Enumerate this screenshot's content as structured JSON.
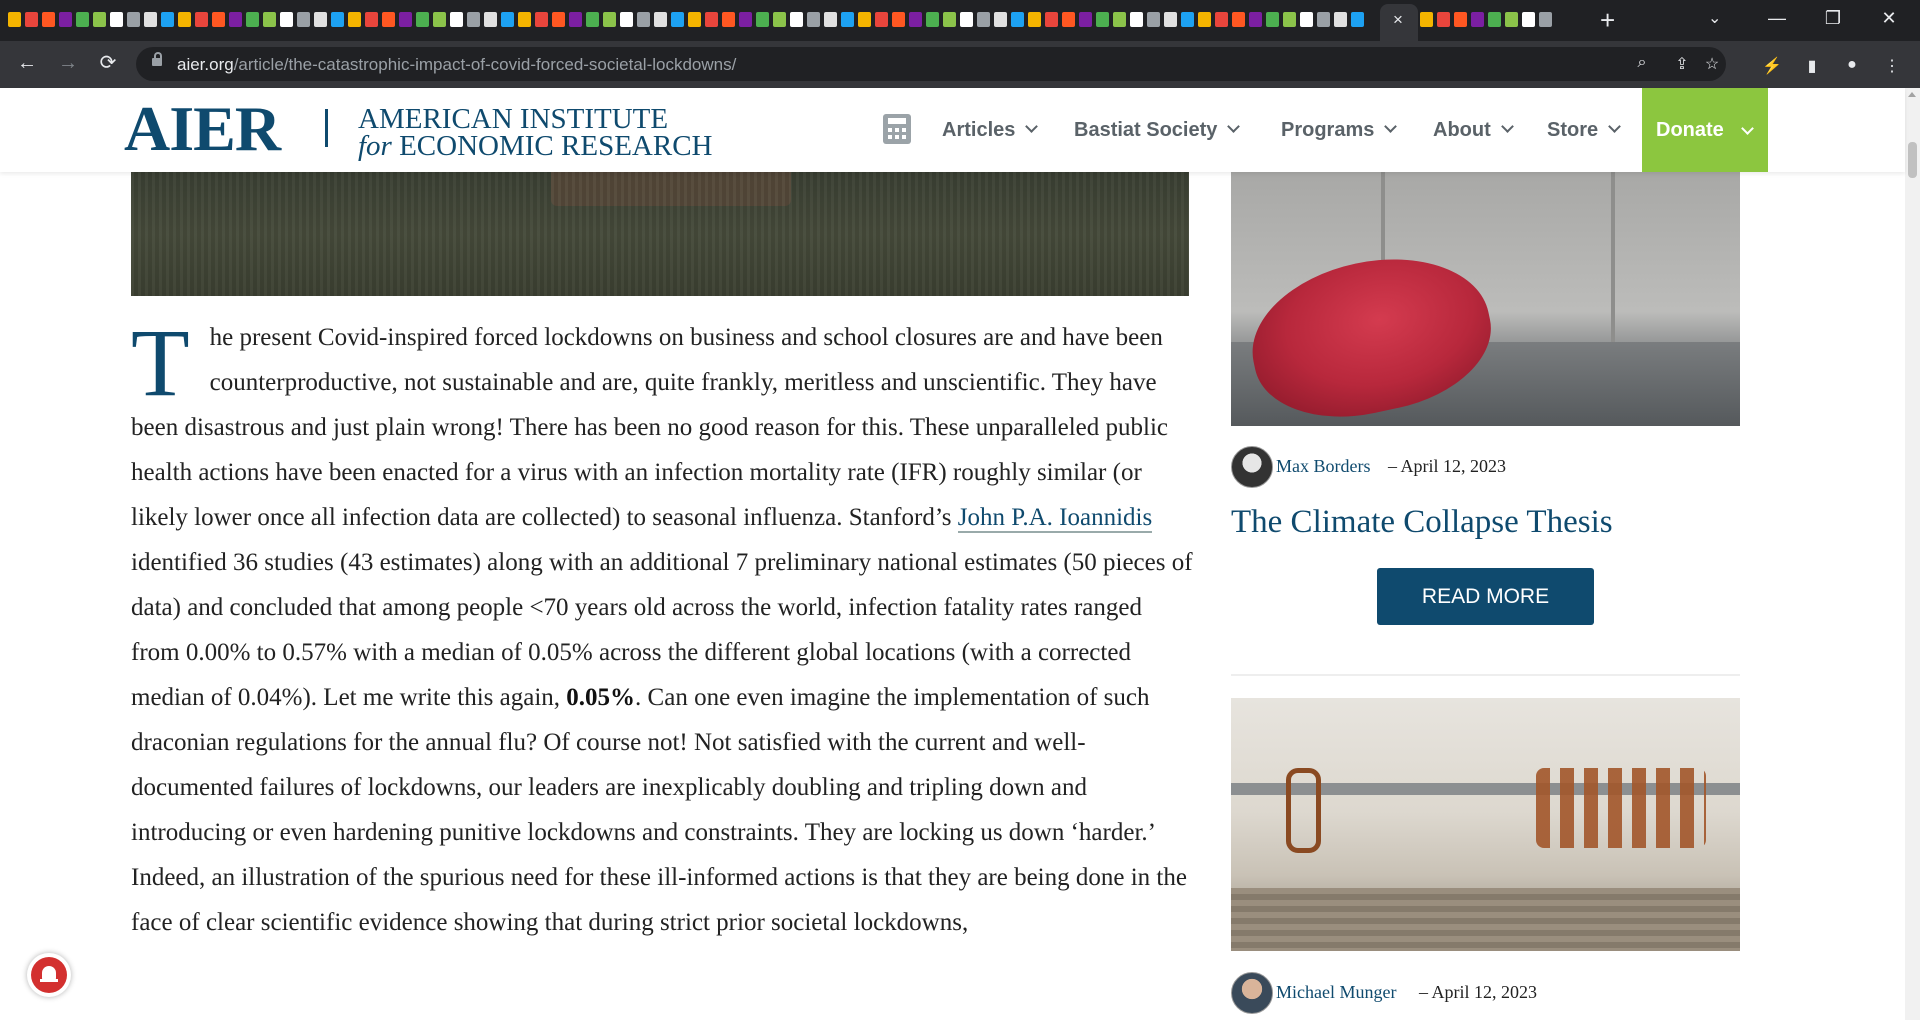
{
  "browser": {
    "url_host": "aier.org",
    "url_path": "/article/the-catastrophic-impact-of-covid-forced-societal-lockdowns/",
    "tab_close_glyph": "×",
    "new_tab_glyph": "+",
    "icons": {
      "back": "←",
      "forward": "→",
      "reload": "⟳",
      "zoom": "⌕",
      "share": "⇪",
      "star": "☆",
      "extension": "⚡",
      "sidepanel": "▮",
      "profile": "●",
      "menu": "⋮",
      "tabsearch": "⌄",
      "minimize": "—",
      "restore": "❐",
      "close": "✕"
    }
  },
  "site": {
    "logo_short": "AIER",
    "logo_line1": "AMERICAN INSTITUTE",
    "logo_line2_italic": "for",
    "logo_line2": "ECONOMIC RESEARCH",
    "nav": [
      "Articles",
      "Bastiat Society",
      "Programs",
      "About",
      "Store"
    ],
    "donate_label": "Donate",
    "brand_color": "#0f4a6e",
    "donate_color": "#8cc63f"
  },
  "article": {
    "dropcap": "T",
    "p1_a": "he present Covid-inspired forced lockdowns on business and school closures are and have been counterproductive, not sustainable and are, quite frankly, meritless and unscientific. They have been disastrous and just plain wrong! There has been no good reason for this. These unparalleled public health actions have been enacted for a virus with an infection mortality rate (IFR) roughly similar (or likely lower once all infection data are collected) to seasonal influenza. Stanford’s",
    "link_text": "John P.A. Ioannidis",
    "p1_b": "identified 36 studies (43 estimates) along with an additional 7 preliminary national estimates (50 pieces of data) and concluded that among people <70 years old across the world, infection fatality rates ranged from 0.00% to 0.57% with a median of 0.05% across the different global locations (with a corrected median of 0.04%). Let me write this again,",
    "bold_text": "0.05%",
    "p1_c": ". Can one even imagine the implementation of such draconian regulations for the annual flu? Of course not! Not satisfied with the current and well-documented failures of lockdowns, our leaders are inexplicably doubling and tripling down and introducing or even hardening punitive lockdowns and constraints. They are locking us down ‘harder.’ Indeed, an illustration of the spurious need for these ill-informed actions is that they are being done in the face of clear scientific evidence showing that during strict prior societal lockdowns,"
  },
  "sidebar": {
    "card1": {
      "author": "Max Borders",
      "date": "– April 12, 2023",
      "title": "The Climate Collapse Thesis",
      "button": "READ MORE"
    },
    "card2": {
      "author": "Michael Munger",
      "date": "– April 12, 2023"
    }
  }
}
